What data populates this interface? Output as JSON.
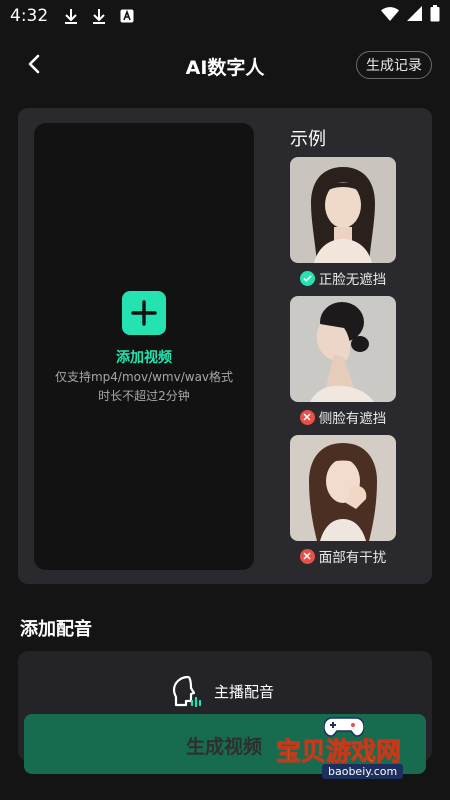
{
  "status_bar": {
    "time": "4:32"
  },
  "header": {
    "title": "AI数字人",
    "history_label": "生成记录"
  },
  "upload": {
    "add_label": "添加视频",
    "hint_line1": "仅支持mp4/mov/wmv/wav格式",
    "hint_line2": "时长不超过2分钟"
  },
  "examples": {
    "title": "示例",
    "items": [
      {
        "caption": "正脸无遮挡",
        "status": "ok"
      },
      {
        "caption": "侧脸有遮挡",
        "status": "bad"
      },
      {
        "caption": "面部有干扰",
        "status": "bad"
      }
    ]
  },
  "voice": {
    "section_title": "添加配音",
    "option_label": "主播配音"
  },
  "generate": {
    "label": "生成视频"
  },
  "watermark": {
    "name": "宝贝游戏网",
    "domain": "baobeiy.com"
  },
  "colors": {
    "accent": "#25e3b1",
    "ok": "#25e3b1",
    "bad": "#e8504a",
    "generate_bg": "#176b4f"
  }
}
